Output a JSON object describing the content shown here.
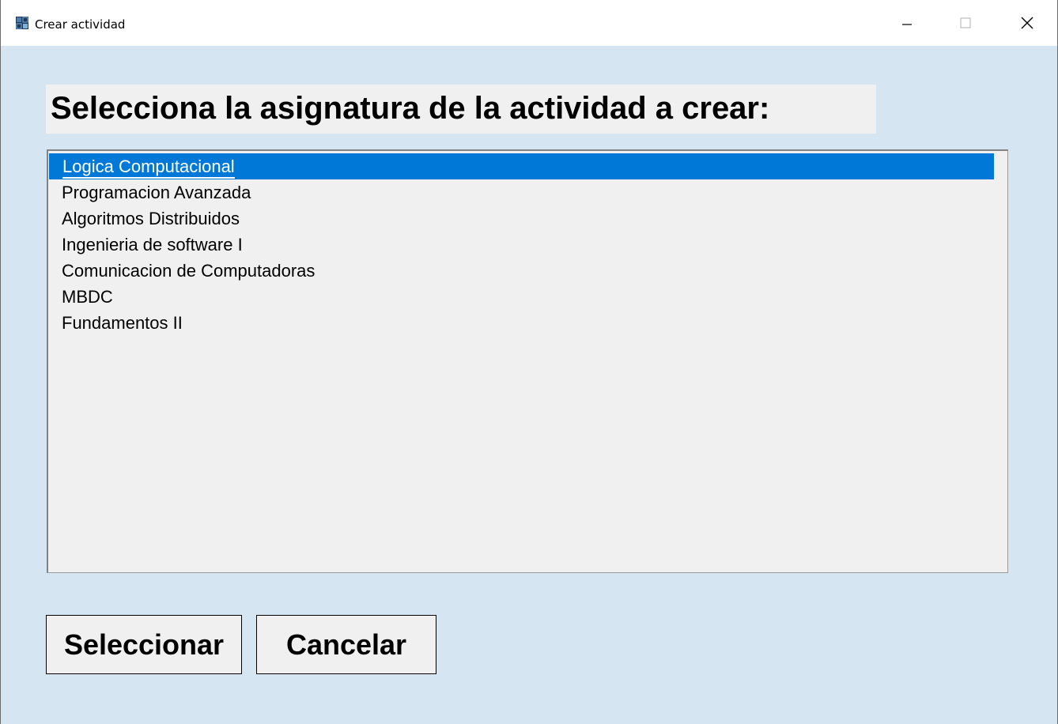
{
  "window": {
    "title": "Crear actividad"
  },
  "icons": {
    "app": "app-logo-icon",
    "minimize": "minimize-icon",
    "maximize": "maximize-icon",
    "close": "close-icon"
  },
  "main": {
    "heading": "Selecciona la asignatura de la actividad a crear:",
    "list": {
      "selected_index": 0,
      "items": [
        "Logica Computacional",
        "Programacion Avanzada",
        "Algoritmos Distribuidos",
        "Ingenieria de software I",
        "Comunicacion de Computadoras",
        "MBDC",
        "Fundamentos II"
      ]
    }
  },
  "buttons": {
    "select_label": "Seleccionar",
    "cancel_label": "Cancelar"
  },
  "colors": {
    "background": "#d5e6f2",
    "selection": "#0078d7",
    "list_background": "#f0f0f0"
  }
}
